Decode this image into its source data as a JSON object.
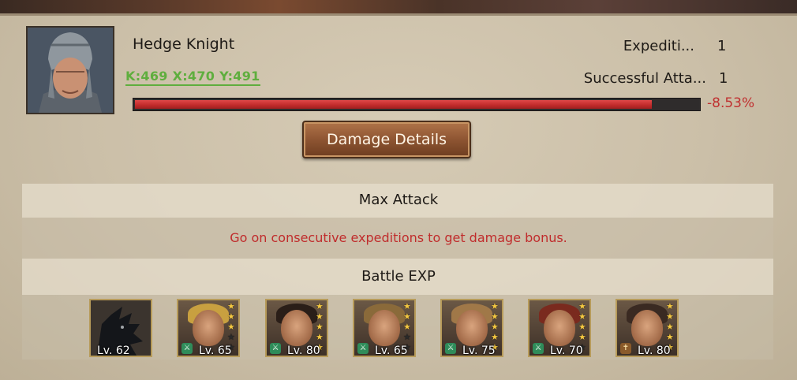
{
  "player": {
    "name": "Hedge Knight",
    "coords": "K:469 X:470 Y:491"
  },
  "stats": [
    {
      "label": "Expediti...",
      "value": "1"
    },
    {
      "label": "Successful Atta...",
      "value": "1"
    }
  ],
  "damage_bar": {
    "fill_fraction": 0.917,
    "percent_text": "-8.53%"
  },
  "buttons": {
    "damage_details": "Damage Details"
  },
  "sections": {
    "max_attack": "Max Attack",
    "bonus_hint": "Go on consecutive expeditions to get damage bonus.",
    "battle_exp": "Battle EXP"
  },
  "heroes": [
    {
      "level": "Lv. 62",
      "stars": 0,
      "class": "none",
      "portrait": "dragon-icon"
    },
    {
      "level": "Lv. 65",
      "stars": 3,
      "class": "green",
      "portrait": "gold-armored-warrior"
    },
    {
      "level": "Lv. 80",
      "stars": 5,
      "class": "green",
      "portrait": "dark-haired-warrior"
    },
    {
      "level": "Lv. 65",
      "stars": 3,
      "class": "green",
      "portrait": "blond-knight"
    },
    {
      "level": "Lv. 75",
      "stars": 5,
      "class": "green",
      "portrait": "long-haired-knight"
    },
    {
      "level": "Lv. 70",
      "stars": 4,
      "class": "green",
      "portrait": "red-haired-woman"
    },
    {
      "level": "Lv. 80",
      "stars": 5,
      "class": "gold",
      "portrait": "dark-haired-woman"
    }
  ],
  "colors": {
    "bar_fill": "#d03a3a",
    "coords_link": "#5fae3e",
    "hint_text": "#c02c2c",
    "button_bg": "#8e5532"
  }
}
